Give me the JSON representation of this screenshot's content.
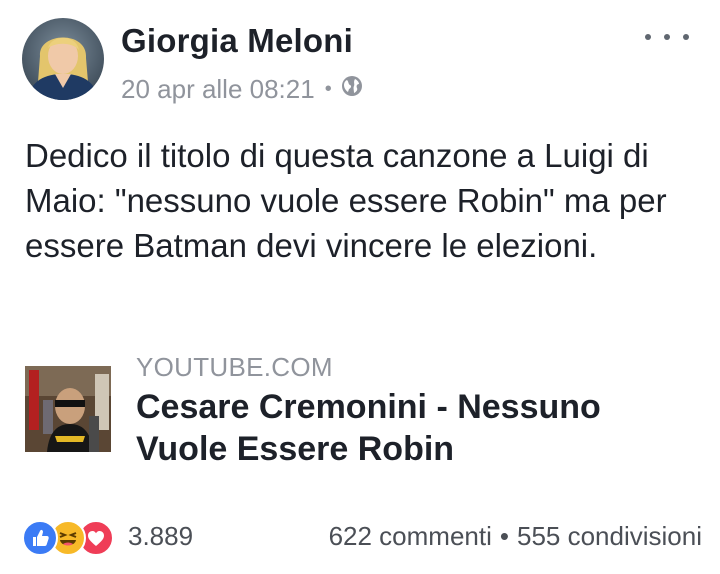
{
  "post": {
    "author": "Giorgia Meloni",
    "timestamp": "20 apr alle 08:21",
    "separator": "•",
    "privacy_icon": "globe-icon",
    "more_icon": "more-options-icon",
    "text": "Dedico il titolo di questa canzone a Luigi di Maio: \"nessuno vuole essere Robin\" ma per essere Batman devi vincere le elezioni."
  },
  "link": {
    "domain": "YOUTUBE.COM",
    "title": "Cesare Cremonini - Nessuno Vuole Essere Robin"
  },
  "footer": {
    "reaction_icons": [
      "like-reaction-icon",
      "haha-reaction-icon",
      "love-reaction-icon"
    ],
    "reaction_count": "3.889",
    "comments": "622 commenti",
    "separator": "•",
    "shares": "555 condivisioni"
  },
  "colors": {
    "like": "#3b7bf5",
    "haha": "#f7b928",
    "love": "#ef3d57",
    "text": "#1d2129",
    "meta": "#90949c"
  }
}
